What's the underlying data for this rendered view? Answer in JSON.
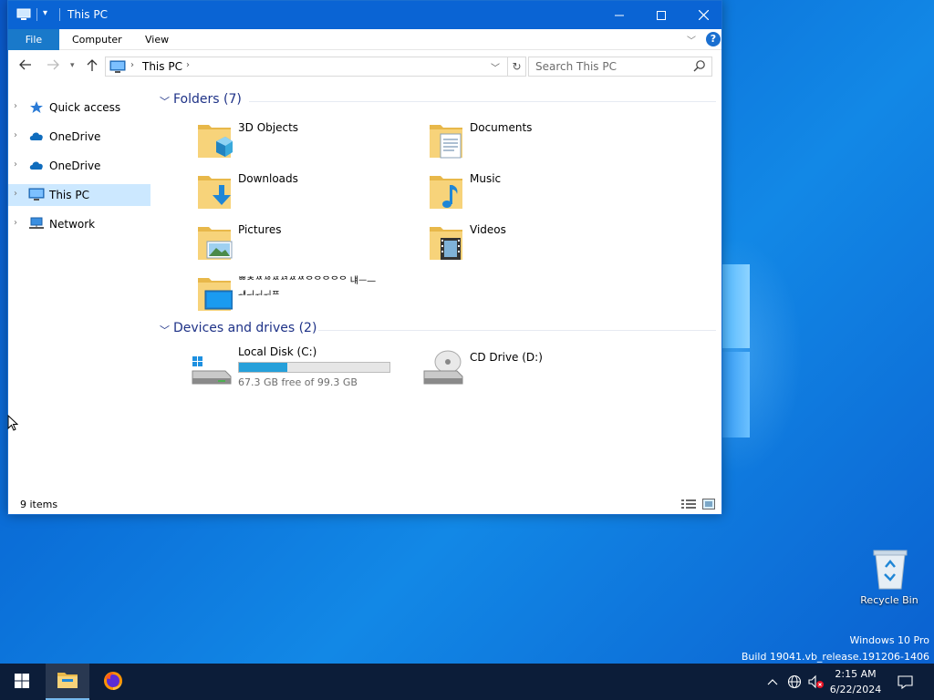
{
  "window": {
    "title": "This PC",
    "controls": {
      "minimize": "—",
      "maximize": "☐",
      "close": "✕"
    }
  },
  "ribbon": {
    "tabs": [
      "File",
      "Computer",
      "View"
    ],
    "help": "?"
  },
  "address": {
    "breadcrumb": "This PC",
    "search_placeholder": "Search This PC"
  },
  "nav_pane": {
    "items": [
      {
        "label": "Quick access",
        "icon": "star-icon"
      },
      {
        "label": "OneDrive",
        "icon": "cloud-icon"
      },
      {
        "label": "OneDrive",
        "icon": "cloud-icon"
      },
      {
        "label": "This PC",
        "icon": "computer-icon",
        "selected": true
      },
      {
        "label": "Network",
        "icon": "network-icon"
      }
    ]
  },
  "folders": {
    "header": "Folders (7)",
    "items": [
      {
        "label": "3D Objects",
        "icon": "3d-objects-folder-icon"
      },
      {
        "label": "Documents",
        "icon": "documents-folder-icon"
      },
      {
        "label": "Downloads",
        "icon": "downloads-folder-icon"
      },
      {
        "label": "Music",
        "icon": "music-folder-icon"
      },
      {
        "label": "Pictures",
        "icon": "pictures-folder-icon"
      },
      {
        "label": "Videos",
        "icon": "videos-folder-icon"
      },
      {
        "label": "ᄈᄎᄷᄵᄶᄸᄶᄷᄋᄋᄋᄋᄋ 냬ᅳ—ᅫᅴᅱᅱᄑ",
        "icon": "desktop-folder-icon"
      }
    ]
  },
  "drives": {
    "header": "Devices and drives (2)",
    "items": [
      {
        "label": "Local Disk (C:)",
        "free": "67.3 GB free of 99.3 GB",
        "used_fraction": 0.322,
        "icon": "windows-drive-icon"
      },
      {
        "label": "CD Drive (D:)",
        "icon": "cd-drive-icon"
      }
    ]
  },
  "status": {
    "count": "9 items"
  },
  "desktop": {
    "recycle_bin": "Recycle Bin",
    "watermark_line1": "Windows 10 Pro",
    "watermark_line2": "Build 19041.vb_release.191206-1406"
  },
  "taskbar": {
    "time": "2:15 AM",
    "date": "6/22/2024"
  },
  "colors": {
    "accent": "#0a64d4",
    "file_tab": "#1979ca",
    "group_header": "#1e3287",
    "selected_nav": "#cce8ff",
    "drive_bar": "#26a0da",
    "taskbar": "#0c1d39"
  }
}
